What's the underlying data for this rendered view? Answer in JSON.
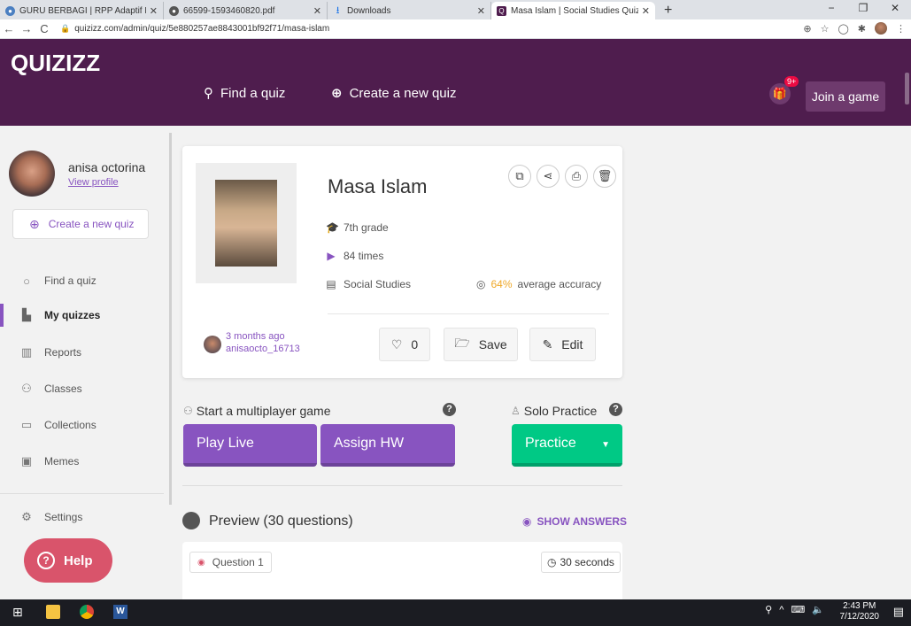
{
  "browser": {
    "tabs": [
      {
        "title": "GURU BERBAGI | RPP Adaptif Lo",
        "favicon_color": "#4a7fc1"
      },
      {
        "title": "66599-1593460820.pdf",
        "favicon_color": "#555555"
      },
      {
        "title": "Downloads",
        "favicon_color": "#1a73e8"
      },
      {
        "title": "Masa Islam | Social Studies Quiz",
        "favicon_color": "#4f1d4e"
      }
    ],
    "url": "quizizz.com/admin/quiz/5e880257ae8843001bf92f71/masa-islam"
  },
  "header": {
    "logo": "QUIZIZZ",
    "find_quiz": "Find a quiz",
    "create_quiz": "Create a new quiz",
    "gift_badge": "9+",
    "join_game": "Join a game"
  },
  "sidebar": {
    "user_name": "anisa octorina",
    "view_profile": "View profile",
    "create_quiz": "Create a new quiz",
    "items": [
      {
        "label": "Find a quiz",
        "icon": "search-icon"
      },
      {
        "label": "My quizzes",
        "icon": "file-icon"
      },
      {
        "label": "Reports",
        "icon": "chart-icon"
      },
      {
        "label": "Classes",
        "icon": "users-icon"
      },
      {
        "label": "Collections",
        "icon": "folder-icon"
      },
      {
        "label": "Memes",
        "icon": "image-icon"
      }
    ],
    "settings": "Settings",
    "help": "Help"
  },
  "quiz": {
    "title": "Masa Islam",
    "grade": "7th grade",
    "plays": "84 times",
    "subject": "Social Studies",
    "accuracy_pct": "64%",
    "accuracy_label": "average accuracy",
    "author_time": "3 months ago",
    "author_name": "anisaocto_16713",
    "likes": "0",
    "save": "Save",
    "edit": "Edit"
  },
  "game": {
    "multiplayer_label": "Start a multiplayer game",
    "solo_label": "Solo Practice",
    "play_live": "Play Live",
    "assign_hw": "Assign HW",
    "practice": "Practice"
  },
  "preview": {
    "title": "Preview (30 questions)",
    "show_answers": "SHOW ANSWERS",
    "question_label": "Question 1",
    "question_time": "30 seconds"
  },
  "taskbar": {
    "time": "2:43 PM",
    "date": "7/12/2020"
  }
}
